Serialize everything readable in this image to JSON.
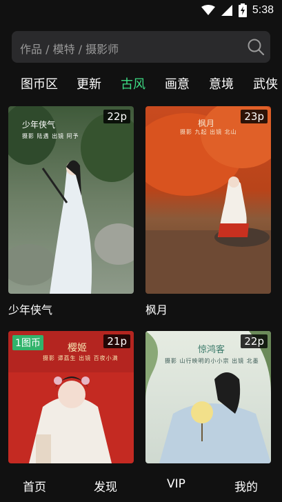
{
  "status_bar": {
    "time": "5:38",
    "icons": [
      "wifi-icon",
      "signal-icon",
      "battery-charging-icon"
    ]
  },
  "search": {
    "placeholder": "作品 / 模特 / 摄影师",
    "icon": "search-icon"
  },
  "tabs": [
    {
      "label": "图币区",
      "active": false
    },
    {
      "label": "更新",
      "active": false
    },
    {
      "label": "古风",
      "active": true
    },
    {
      "label": "画意",
      "active": false
    },
    {
      "label": "意境",
      "active": false
    },
    {
      "label": "武侠",
      "active": false
    }
  ],
  "colors": {
    "accent": "#3ddc84",
    "background": "#111111",
    "coin_badge": "#31b36b"
  },
  "cards": [
    {
      "title": "少年侠气",
      "count": "22p",
      "overlay_title": "少年侠气",
      "overlay_credit": "摄影 陆遇   出镜 阿予"
    },
    {
      "title": "枫月",
      "count": "23p",
      "overlay_title": "枫月",
      "overlay_credit": "摄影 九起   出镜 北山"
    },
    {
      "title": "",
      "count": "21p",
      "coin": "1图币",
      "overlay_title": "樱姬",
      "overlay_credit": "摄影 谭荔生   出镜 百夜小满"
    },
    {
      "title": "",
      "count": "22p",
      "overlay_title": "惊鸿客",
      "overlay_credit": "摄影 山行映明的小小宗   出镜 北墨"
    }
  ],
  "bottom_nav": [
    {
      "label": "首页"
    },
    {
      "label": "发现"
    },
    {
      "label": "VIP"
    },
    {
      "label": "我的"
    }
  ]
}
